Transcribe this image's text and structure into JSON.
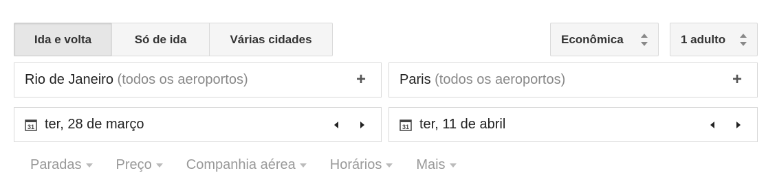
{
  "trip_type": {
    "options": [
      "Ida e volta",
      "Só de ida",
      "Várias cidades"
    ],
    "selected": "Ida e volta"
  },
  "cabin_class": {
    "label": "Econômica",
    "icon": "updown-icon"
  },
  "passengers": {
    "label": "1 adulto",
    "icon": "updown-icon"
  },
  "origin": {
    "city": "Rio de Janeiro",
    "qualifier": "(todos os aeroportos)",
    "icon": "plus-icon"
  },
  "destination": {
    "city": "Paris",
    "qualifier": "(todos os aeroportos)",
    "icon": "plus-icon"
  },
  "departure": {
    "date": "ter, 28 de março",
    "icon": "calendar-icon"
  },
  "return": {
    "date": "ter, 11 de abril",
    "icon": "calendar-icon"
  },
  "filters": [
    {
      "label": "Paradas"
    },
    {
      "label": "Preço"
    },
    {
      "label": "Companhia aérea"
    },
    {
      "label": "Horários"
    },
    {
      "label": "Mais"
    }
  ],
  "colors": {
    "text": "#222222",
    "muted": "#999999",
    "border": "#d9d9d9",
    "button_bg": "#f5f5f5"
  }
}
